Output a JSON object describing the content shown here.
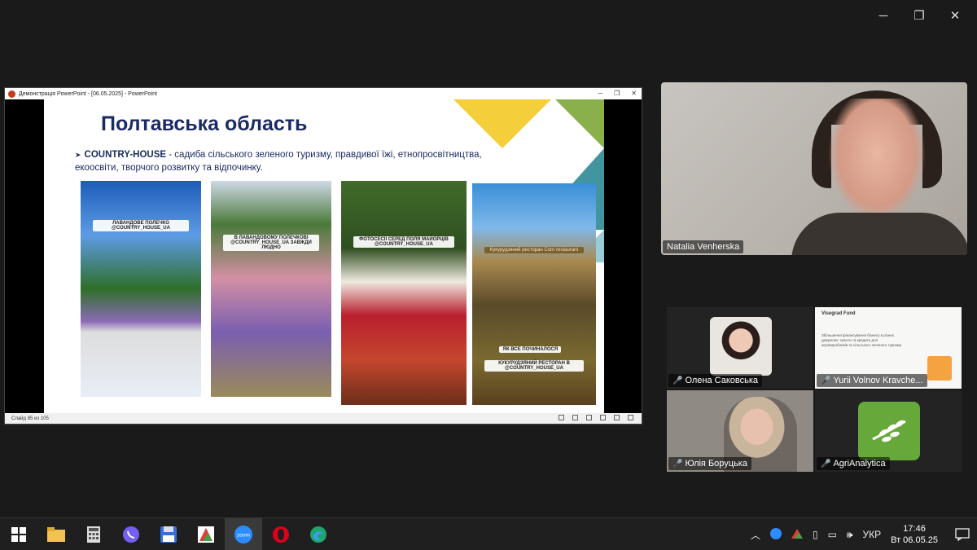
{
  "window_controls": {
    "minimize": "─",
    "restore": "❐",
    "close": "✕"
  },
  "ppt": {
    "title": "Демонстрація PowerPoint - [06.05.2025] - PowerPoint",
    "status": "Слайд 85 из 105"
  },
  "slide": {
    "title": "Полтавська область",
    "bullet_arrow": "➤",
    "bullet_strong": "COUNTRY-HOUSE",
    "bullet_text": " - садиба сільського зеленого туризму, правдивої їжі, етнопросвітництва, екоосвіти, творчого розвитку та відпочинку.",
    "captions": [
      "ЛАВАНДОВЕ ПОЛЕЧКО @COUNTRY_HOUSE_UA",
      "В ЛАВАНДОВОМУ ПОЛЕЧКОВІ @COUNTRY_HOUSE_UA ЗАВЖДИ ЛЮДНО",
      "ФОТОСЕСІЇ СЕРЕД ПОЛЯ МАЙОРЦІВ @COUNTRY_HOUSE_UA",
      "ЯК ВСЕ ПОЧИНАЛОСЯ",
      "КУКУРУДЗЯНИЙ РЕСТОРАН В @COUNTRY_HOUSE_UA"
    ],
    "sign_text": "Кукурудзяний ресторан Corn restaurant"
  },
  "participants": {
    "main": "Natalia Venherska",
    "tiles": [
      "Олена Саковська",
      "Yurii Volnov Kravche...",
      "Юлія Боруцька",
      "AgriAnalytica"
    ],
    "mute_icon": "🎤",
    "vf_logo": "Visegrad Fund",
    "vf_text": "Збільшення фінансування бізнесу в різних джерелах: гранти та кредити для агровиробників та сільського зеленого туризму"
  },
  "taskbar": {
    "lang": "УКР",
    "time": "17:46",
    "date": "Вт 06.05.25",
    "zoom_label": "zoom"
  }
}
